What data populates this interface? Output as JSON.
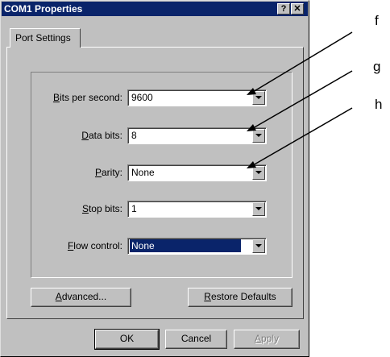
{
  "window": {
    "title": "COM1 Properties",
    "help_button": "?",
    "close_button": "✕"
  },
  "tabs": [
    {
      "label": "Port Settings",
      "active": true
    }
  ],
  "fields": [
    {
      "label_first": "B",
      "label_rest": "its per second:",
      "value": "9600"
    },
    {
      "label_first": "D",
      "label_rest": "ata bits:",
      "value": "8"
    },
    {
      "label_pre": "",
      "label_first": "P",
      "label_rest": "arity:",
      "value": "None"
    },
    {
      "label_first": "S",
      "label_rest": "top bits:",
      "value": "1"
    },
    {
      "label_first": "F",
      "label_rest": "low control:",
      "value": "None"
    }
  ],
  "buttons": {
    "advanced_first": "A",
    "advanced_rest": "dvanced...",
    "restore_first": "R",
    "restore_rest": "estore Defaults",
    "ok": "OK",
    "cancel": "Cancel",
    "apply_first": "A",
    "apply_rest": "pply"
  },
  "callouts": [
    "f",
    "g",
    "h"
  ]
}
